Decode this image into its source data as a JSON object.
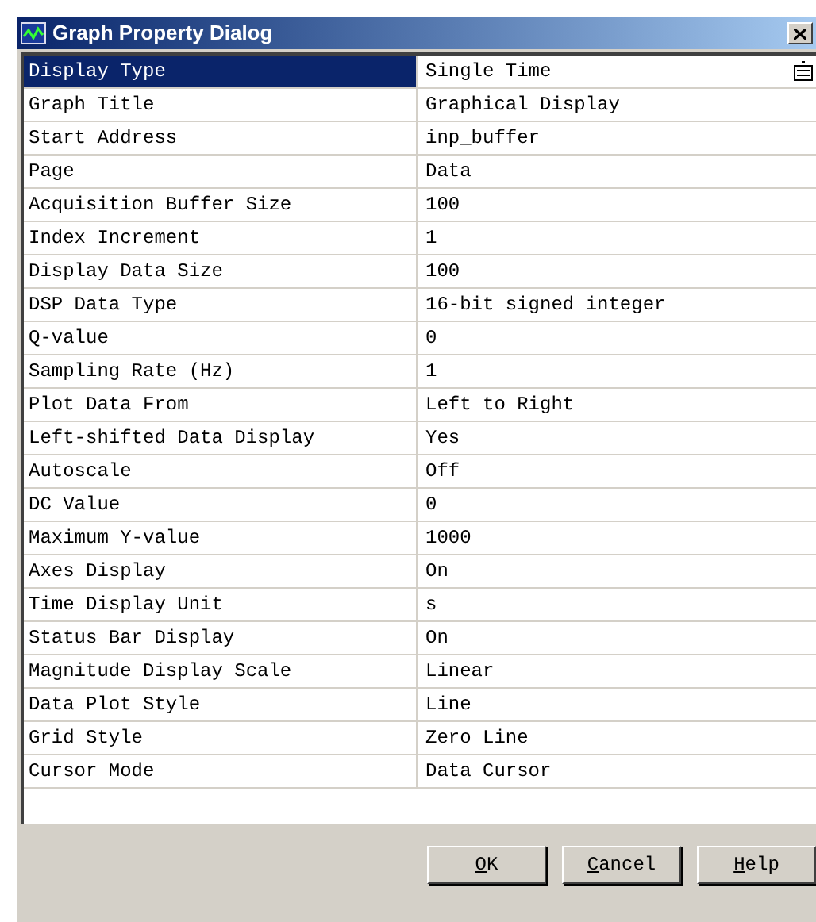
{
  "window": {
    "title": "Graph Property Dialog"
  },
  "properties": [
    {
      "name": "Display Type",
      "value": "Single Time",
      "selected": true
    },
    {
      "name": "Graph Title",
      "value": "Graphical Display",
      "selected": false
    },
    {
      "name": "Start Address",
      "value": "inp_buffer",
      "selected": false
    },
    {
      "name": "Page",
      "value": "Data",
      "selected": false
    },
    {
      "name": "Acquisition Buffer Size",
      "value": "100",
      "selected": false
    },
    {
      "name": "Index Increment",
      "value": "1",
      "selected": false
    },
    {
      "name": "Display Data Size",
      "value": "100",
      "selected": false
    },
    {
      "name": "DSP Data Type",
      "value": "16-bit signed integer",
      "selected": false
    },
    {
      "name": "Q-value",
      "value": "0",
      "selected": false
    },
    {
      "name": "Sampling Rate (Hz)",
      "value": "1",
      "selected": false
    },
    {
      "name": "Plot Data From",
      "value": "Left to Right",
      "selected": false
    },
    {
      "name": "Left-shifted Data Display",
      "value": "Yes",
      "selected": false
    },
    {
      "name": "Autoscale",
      "value": "Off",
      "selected": false
    },
    {
      "name": "DC Value",
      "value": "0",
      "selected": false
    },
    {
      "name": "Maximum Y-value",
      "value": "1000",
      "selected": false
    },
    {
      "name": "Axes Display",
      "value": "On",
      "selected": false
    },
    {
      "name": "Time Display Unit",
      "value": "s",
      "selected": false
    },
    {
      "name": "Status Bar Display",
      "value": "On",
      "selected": false
    },
    {
      "name": "Magnitude Display Scale",
      "value": "Linear",
      "selected": false
    },
    {
      "name": "Data Plot Style",
      "value": "Line",
      "selected": false
    },
    {
      "name": "Grid Style",
      "value": "Zero Line",
      "selected": false
    },
    {
      "name": "Cursor Mode",
      "value": "Data Cursor",
      "selected": false
    }
  ],
  "buttons": [
    "OK",
    "Cancel",
    "Help"
  ]
}
